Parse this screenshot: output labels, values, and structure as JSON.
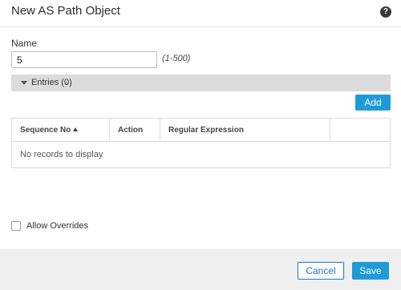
{
  "dialog": {
    "title": "New AS Path Object",
    "help_icon": "question-circle-icon"
  },
  "form": {
    "name_label": "Name",
    "name_value": "5",
    "name_range_hint": "(1-500)"
  },
  "entries": {
    "section_label": "Entries (0)",
    "expanded": true,
    "add_label": "Add",
    "columns": [
      "Sequence No",
      "Action",
      "Regular Expression",
      ""
    ],
    "sort_column": "Sequence No",
    "sort_direction": "ascending",
    "empty_message": "No records to display"
  },
  "options": {
    "allow_overrides_label": "Allow Overrides",
    "allow_overrides_checked": false
  },
  "footer": {
    "cancel_label": "Cancel",
    "save_label": "Save"
  },
  "colors": {
    "primary": "#1e9bd7",
    "section_bar": "#dcdcdc",
    "footer_bg": "#efefef"
  }
}
